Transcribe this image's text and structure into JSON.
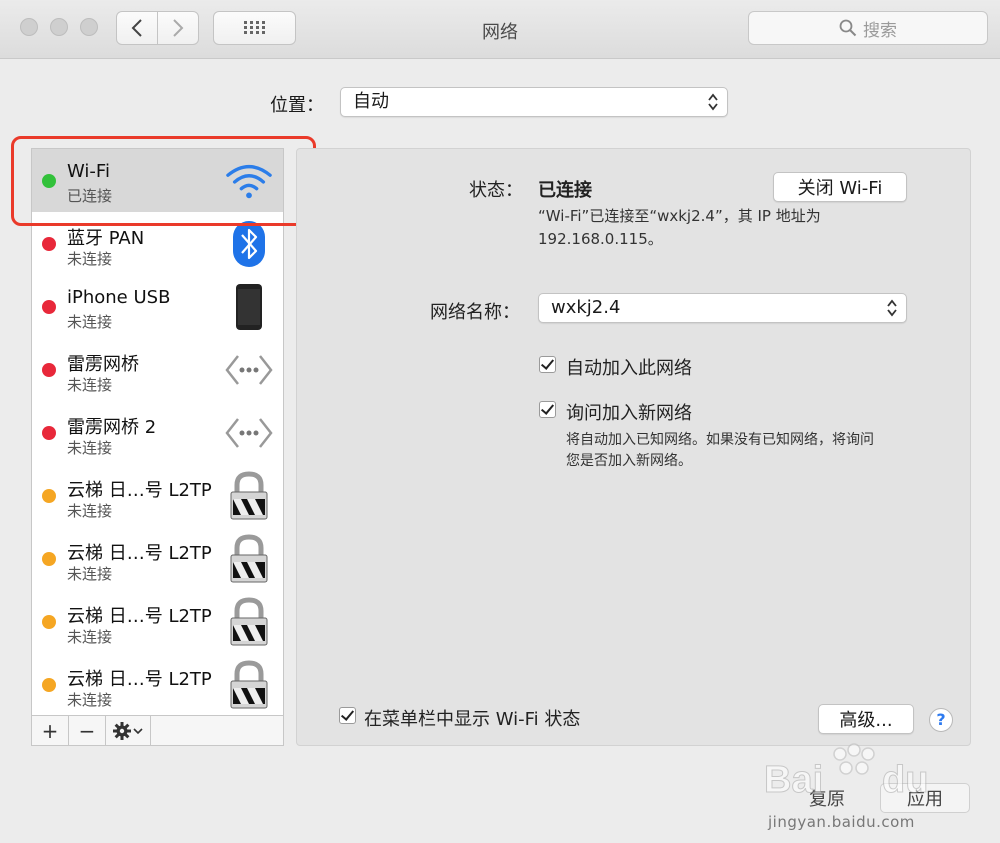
{
  "window": {
    "title": "网络"
  },
  "search": {
    "placeholder": "搜索"
  },
  "location": {
    "label": "位置：",
    "value": "自动"
  },
  "services": [
    {
      "name": "Wi-Fi",
      "status": "已连接",
      "color": "#32c13a",
      "icon": "wifi-icon"
    },
    {
      "name": "蓝牙 PAN",
      "status": "未连接",
      "color": "#e8283a",
      "icon": "bluetooth-icon"
    },
    {
      "name": "iPhone USB",
      "status": "未连接",
      "color": "#e8283a",
      "icon": "iphone-icon"
    },
    {
      "name": "雷雳网桥",
      "status": "未连接",
      "color": "#e8283a",
      "icon": "bridge-icon"
    },
    {
      "name": "雷雳网桥 2",
      "status": "未连接",
      "color": "#e8283a",
      "icon": "bridge-icon"
    },
    {
      "name": "云梯 日…号 L2TP",
      "status": "未连接",
      "color": "#f5a623",
      "icon": "vpn-lock-icon"
    },
    {
      "name": "云梯 日…号 L2TP",
      "status": "未连接",
      "color": "#f5a623",
      "icon": "vpn-lock-icon"
    },
    {
      "name": "云梯 日…号 L2TP",
      "status": "未连接",
      "color": "#f5a623",
      "icon": "vpn-lock-icon"
    },
    {
      "name": "云梯 日…号 L2TP",
      "status": "未连接",
      "color": "#f5a623",
      "icon": "vpn-lock-icon"
    }
  ],
  "toolbar": {
    "add": "+",
    "remove": "−"
  },
  "detail": {
    "status_label": "状态：",
    "status_value": "已连接",
    "toggle_button": "关闭 Wi-Fi",
    "status_desc_line1": "“Wi-Fi”已连接至“wxkj2.4”，其 IP 地址为",
    "status_desc_line2": "192.168.0.115。",
    "network_name_label": "网络名称：",
    "network_name_value": "wxkj2.4",
    "auto_join_label": "自动加入此网络",
    "ask_join_label": "询问加入新网络",
    "ask_desc_line1": "将自动加入已知网络。如果没有已知网络，将询问",
    "ask_desc_line2": "您是否加入新网络。",
    "show_menu_label": "在菜单栏中显示 Wi-Fi 状态",
    "advanced_button": "高级...",
    "help": "?"
  },
  "footer": {
    "revert": "复原",
    "apply": "应用"
  },
  "watermark": {
    "text": "jingyan.baidu.com"
  }
}
